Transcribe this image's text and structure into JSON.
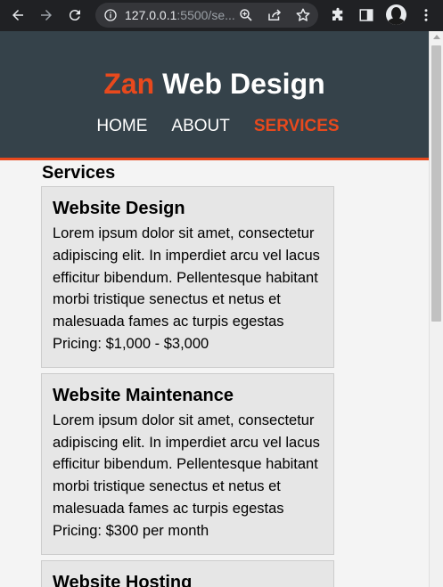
{
  "browser": {
    "url_host": "127.0.0.1",
    "url_rest": ":5500/se..."
  },
  "site": {
    "logo_highlight": "Zan",
    "logo_rest": " Web Design",
    "nav": [
      {
        "label": "Home",
        "current": false
      },
      {
        "label": "About",
        "current": false
      },
      {
        "label": "Services",
        "current": true
      }
    ]
  },
  "page": {
    "title": "Services",
    "services": [
      {
        "name": "Website Design",
        "description": "Lorem ipsum dolor sit amet, consectetur adipiscing elit. In imperdiet arcu vel lacus efficitur bibendum. Pellentesque habitant morbi tristique senectus et netus et malesuada fames ac turpis egestas",
        "pricing": "Pricing: $1,000 - $3,000"
      },
      {
        "name": "Website Maintenance",
        "description": "Lorem ipsum dolor sit amet, consectetur adipiscing elit. In imperdiet arcu vel lacus efficitur bibendum. Pellentesque habitant morbi tristique senectus et netus et malesuada fames ac turpis egestas",
        "pricing": "Pricing: $300 per month"
      },
      {
        "name": "Website Hosting",
        "description": "",
        "pricing": ""
      }
    ]
  },
  "colors": {
    "header_bg": "#35424a",
    "accent": "#e8491d",
    "card_bg": "#e6e6e6",
    "page_bg": "#f4f4f4"
  },
  "icons": {
    "back": "arrow-left-icon",
    "forward": "arrow-right-icon",
    "reload": "reload-icon",
    "site_info": "info-icon",
    "zoom": "zoom-icon",
    "share": "share-icon",
    "bookmark": "star-icon",
    "extensions": "puzzle-icon",
    "side_panel": "side-panel-icon",
    "profile": "avatar",
    "menu": "kebab-menu-icon"
  }
}
